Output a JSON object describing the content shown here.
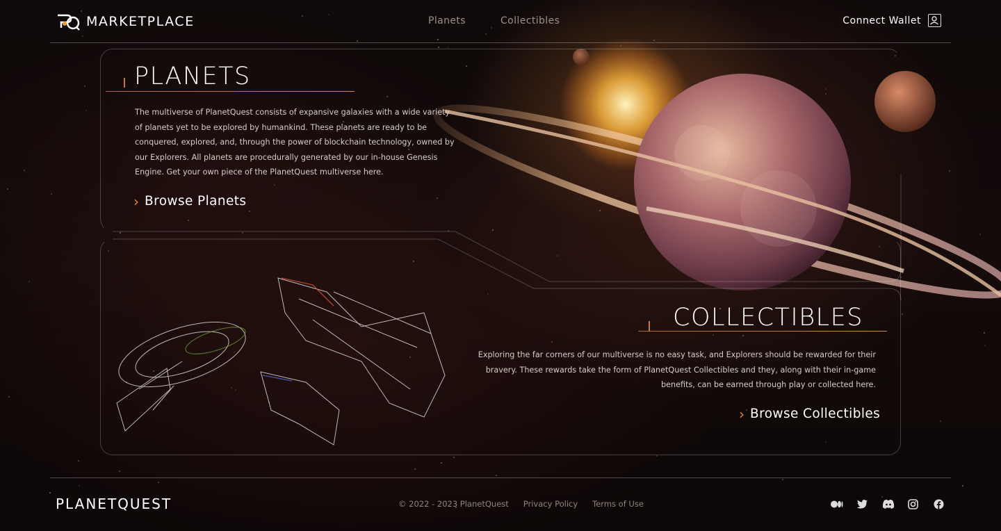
{
  "header": {
    "brand": "MARKETPLACE",
    "nav": [
      {
        "label": "Planets"
      },
      {
        "label": "Collectibles"
      }
    ],
    "wallet_label": "Connect Wallet",
    "wallet_icon": "user-icon"
  },
  "planets": {
    "title": "PLANETS",
    "description": "The multiverse of PlanetQuest consists of expansive galaxies with a wide variety of planets yet to be explored by humankind. These planets are ready to be conquered, explored, and, through the power of blockchain technology, owned by our Explorers. All planets are procedurally generated by our in-house Genesis Engine. Get your own piece of the PlanetQuest multiverse here.",
    "cta": "Browse Planets"
  },
  "collectibles": {
    "title": "COLLECTIBLES",
    "description": "Exploring the far corners of our multiverse is no easy task, and Explorers should be rewarded for their bravery. These rewards take the form of PlanetQuest Collectibles and they, along with their in-game benefits, can be earned through play or collected here.",
    "cta": "Browse Collectibles"
  },
  "footer": {
    "brand": "PLANETQUEST",
    "copyright": "© 2022 - 2023 PlanetQuest",
    "privacy": "Privacy Policy",
    "terms": "Terms of Use",
    "social_icons": [
      "medium-icon",
      "twitter-icon",
      "discord-icon",
      "instagram-icon",
      "facebook-icon"
    ]
  },
  "colors": {
    "accent": "#e0853a",
    "background": "#0c0707",
    "text": "#ffffff"
  }
}
